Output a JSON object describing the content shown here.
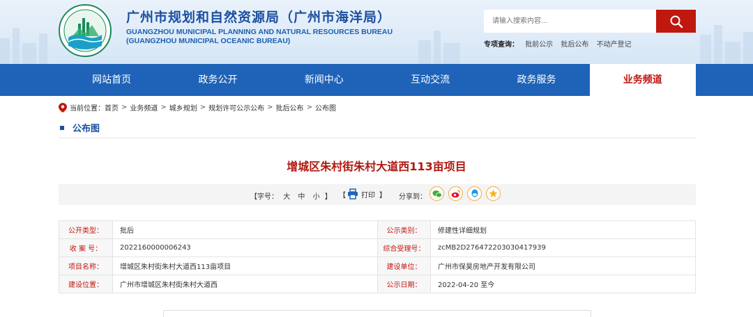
{
  "header": {
    "title_cn": "广州市规划和自然资源局（广州市海洋局）",
    "title_en_line1": "GUANGZHOU MUNICIPAL PLANNING AND NATURAL RESOURCES BUREAU",
    "title_en_line2": "(GUANGZHOU MUNICIPAL OCEANIC BUREAU)",
    "logo_text": "广州市规划和自然资源局",
    "search": {
      "placeholder": "请输入搜索内容...",
      "icon": "search-icon"
    },
    "special": {
      "label": "专项查询：",
      "links": [
        "批前公示",
        "批后公布",
        "不动产登记"
      ]
    }
  },
  "nav": {
    "items": [
      {
        "label": "网站首页",
        "active": false
      },
      {
        "label": "政务公开",
        "active": false
      },
      {
        "label": "新闻中心",
        "active": false
      },
      {
        "label": "互动交流",
        "active": false
      },
      {
        "label": "政务服务",
        "active": false
      },
      {
        "label": "业务频道",
        "active": true
      }
    ]
  },
  "breadcrumb": {
    "prefix": "当前位置：",
    "items": [
      "首页",
      "业务频道",
      "城乡规划",
      "规划许可公示公布",
      "批后公布",
      "公布图"
    ],
    "separator": ">"
  },
  "section_title": "公布图",
  "article_title": "增城区朱村街朱村大道西113亩项目",
  "toolbar": {
    "font_label": "【字号：",
    "font_sizes": [
      "大",
      "中",
      "小"
    ],
    "font_close": "】",
    "print_open": "【",
    "print_label": "打印",
    "print_close": "】",
    "share_label": "分享到：",
    "share_icons": [
      "wechat-icon",
      "weibo-icon",
      "qq-icon",
      "qzone-icon"
    ]
  },
  "info_rows": [
    {
      "k1": "公开类型：",
      "v1": "批后",
      "k2": "公示类别：",
      "v2": "修建性详细规划"
    },
    {
      "k1": "收 案 号：",
      "v1": "2022160000006243",
      "k2": "综合受理号：",
      "v2": "zcMB2D276472203030417939"
    },
    {
      "k1": "项目名称：",
      "v1": "增城区朱村街朱村大道西113亩项目",
      "k2": "建设单位：",
      "v2": "广州市保昊房地产开发有限公司"
    },
    {
      "k1": "建设位置：",
      "v1": "广州市增城区朱村街朱村大道西",
      "k2": "公示日期：",
      "v2": "2022-04-20 至今"
    }
  ],
  "colors": {
    "brand_blue": "#1e63b8",
    "accent_red": "#c0170f",
    "title_red": "#b0180f"
  }
}
